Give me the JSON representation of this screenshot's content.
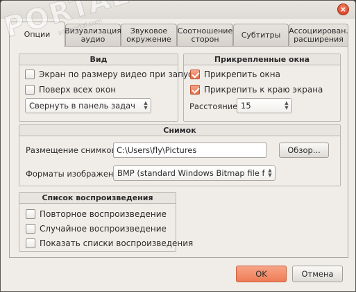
{
  "window": {
    "close_glyph": "×"
  },
  "tabs": [
    {
      "label": "Опции",
      "active": true
    },
    {
      "label": "Визуализация\nаудио"
    },
    {
      "label": "Звуковое\nокружение"
    },
    {
      "label": "Соотношение\nсторон"
    },
    {
      "label": "Субтитры"
    },
    {
      "label": "Ассоциирован.\nрасширения"
    }
  ],
  "view_group": {
    "title": "Вид",
    "fit_video_label": "Экран по размеру видео при запус",
    "fit_video_checked": false,
    "on_top_label": "Поверх всех окон",
    "on_top_checked": false,
    "minimize_select": "Свернуть в панель задач"
  },
  "snap_group": {
    "title": "Прикрепленные окна",
    "snap_windows_label": "Прикрепить окна",
    "snap_windows_checked": true,
    "snap_edge_label": "Прикрепить к краю экрана",
    "snap_edge_checked": true,
    "distance_label": "Расстояние:",
    "distance_value": "15"
  },
  "snapshot_group": {
    "title": "Снимок",
    "location_label": "Размещение снимков:",
    "location_value": "C:\\Users\\fly\\Pictures",
    "browse_button": "Обзор...",
    "formats_label": "Форматы изображений:",
    "formats_value": "BMP (standard Windows Bitmap file format)"
  },
  "playlist_group": {
    "title": "Список воспроизведения",
    "repeat_label": "Повторное воспроизведение",
    "repeat_checked": false,
    "shuffle_label": "Случайное воспроизведение",
    "shuffle_checked": false,
    "show_lists_label": "Показать списки воспроизведения",
    "show_lists_checked": false
  },
  "footer": {
    "ok_button": "OK",
    "cancel_button": "Отмена"
  },
  "watermark": {
    "main": "PORTAL",
    "sub": "softportal.com"
  },
  "colors": {
    "accent": "#ee7c55",
    "background": "#f0ede8"
  }
}
